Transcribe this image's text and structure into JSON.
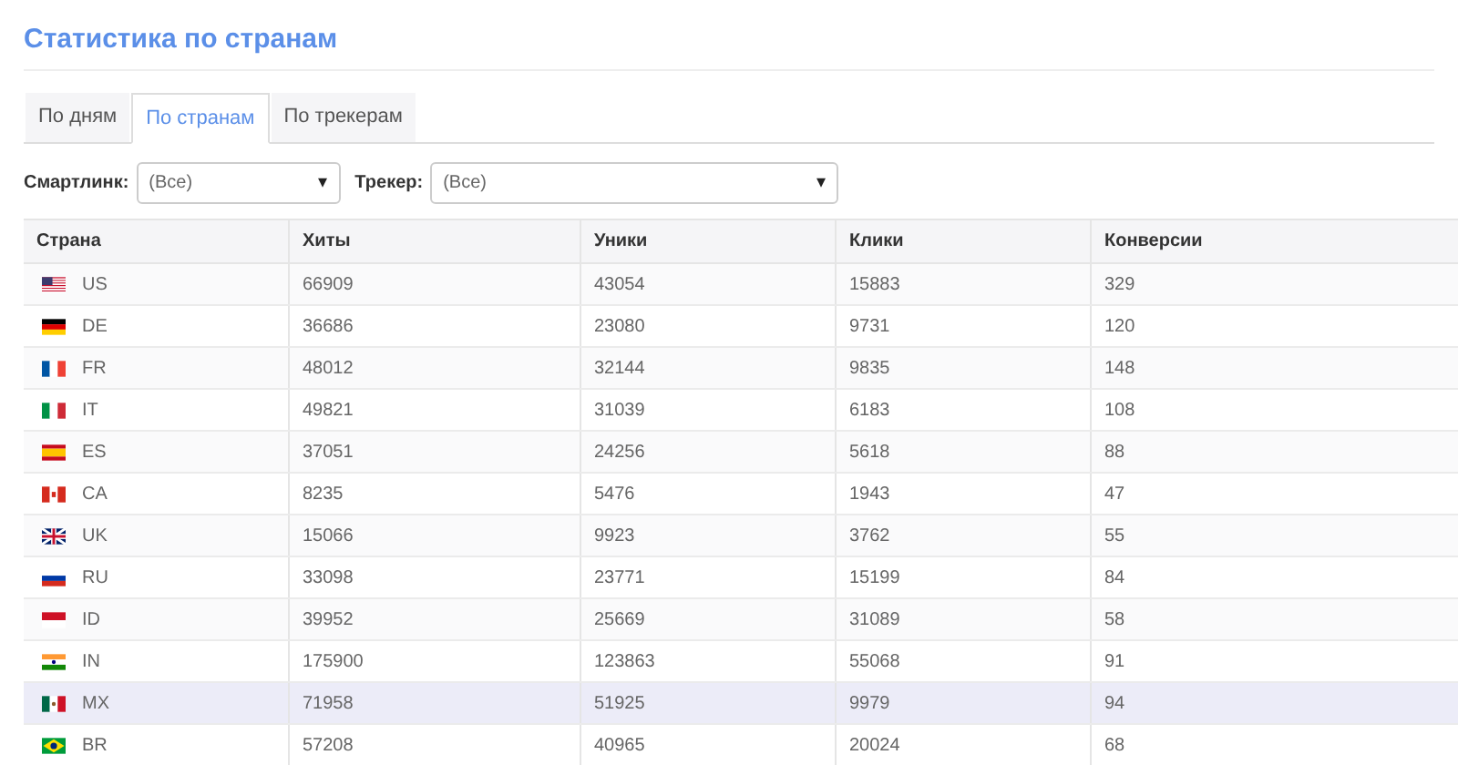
{
  "page_title": "Статистика по странам",
  "tabs": [
    {
      "label": "По дням",
      "selected": false
    },
    {
      "label": "По странам",
      "selected": true
    },
    {
      "label": "По трекерам",
      "selected": false
    }
  ],
  "filters": [
    {
      "label": "Смартлинк:",
      "value": "(Все)",
      "caret": "▾"
    },
    {
      "label": "Трекер:",
      "value": "(Все)",
      "caret": "▾"
    }
  ],
  "table": {
    "columns": [
      "Страна",
      "Хиты",
      "Уники",
      "Клики",
      "Конверсии"
    ],
    "rows": [
      {
        "cells": [
          "US",
          "66909",
          "43054",
          "15883",
          "329"
        ],
        "highlighted": false
      },
      {
        "cells": [
          "DE",
          "36686",
          "23080",
          "9731",
          "120"
        ],
        "highlighted": false
      },
      {
        "cells": [
          "FR",
          "48012",
          "32144",
          "9835",
          "148"
        ],
        "highlighted": false
      },
      {
        "cells": [
          "IT",
          "49821",
          "31039",
          "6183",
          "108"
        ],
        "highlighted": false
      },
      {
        "cells": [
          "ES",
          "37051",
          "24256",
          "5618",
          "88"
        ],
        "highlighted": false
      },
      {
        "cells": [
          "CA",
          "8235",
          "5476",
          "1943",
          "47"
        ],
        "highlighted": false
      },
      {
        "cells": [
          "UK",
          "15066",
          "9923",
          "3762",
          "55"
        ],
        "highlighted": false
      },
      {
        "cells": [
          "RU",
          "33098",
          "23771",
          "15199",
          "84"
        ],
        "highlighted": false
      },
      {
        "cells": [
          "ID",
          "39952",
          "25669",
          "31089",
          "58"
        ],
        "highlighted": false
      },
      {
        "cells": [
          "IN",
          "175900",
          "123863",
          "55068",
          "91"
        ],
        "highlighted": false
      },
      {
        "cells": [
          "MX",
          "71958",
          "51925",
          "9979",
          "94"
        ],
        "highlighted": true
      },
      {
        "cells": [
          "BR",
          "57208",
          "40965",
          "20024",
          "68"
        ],
        "highlighted": false
      }
    ]
  }
}
